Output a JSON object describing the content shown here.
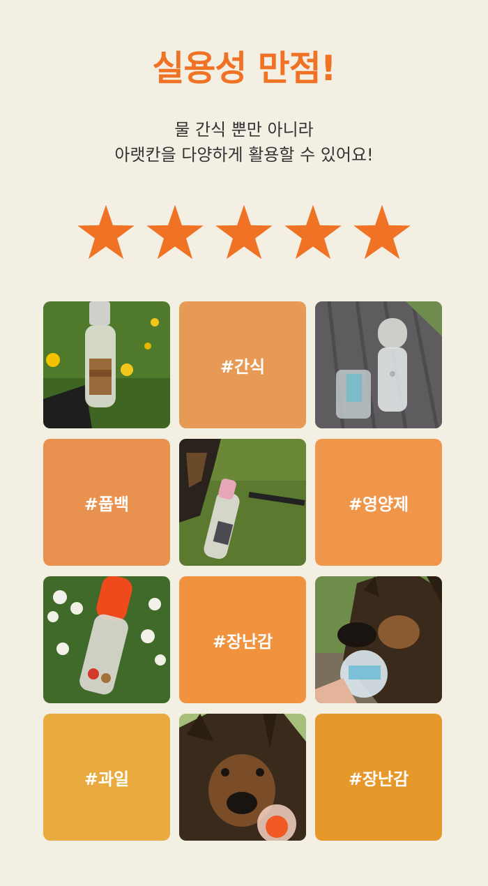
{
  "header": {
    "title": "실용성 만점!",
    "subtitle_line1": "물 간식 뿐만 아니라",
    "subtitle_line2": "아랫칸을 다양하게 활용할 수 있어요!"
  },
  "rating": {
    "stars": 5,
    "max": 5,
    "star_color": "#f07325"
  },
  "grid": {
    "tiles": [
      {
        "type": "photo",
        "icon": "bottle-flowers-photo"
      },
      {
        "type": "tag",
        "label": "#간식",
        "color": "#e79a55"
      },
      {
        "type": "photo",
        "icon": "bottle-deck-photo"
      },
      {
        "type": "tag",
        "label": "#풉백",
        "color": "#e9914f"
      },
      {
        "type": "photo",
        "icon": "dog-grass-bottle-photo"
      },
      {
        "type": "tag",
        "label": "#영양제",
        "color": "#f0964a"
      },
      {
        "type": "photo",
        "icon": "orange-bottle-clover-photo"
      },
      {
        "type": "tag",
        "label": "#장난감",
        "color": "#f0923e"
      },
      {
        "type": "photo",
        "icon": "shepherd-dog-toy-photo"
      },
      {
        "type": "tag",
        "label": "#과일",
        "color": "#e9aa3f"
      },
      {
        "type": "photo",
        "icon": "shepherd-dog-ball-photo"
      },
      {
        "type": "tag",
        "label": "#장난감",
        "color": "#e6992a"
      }
    ]
  }
}
